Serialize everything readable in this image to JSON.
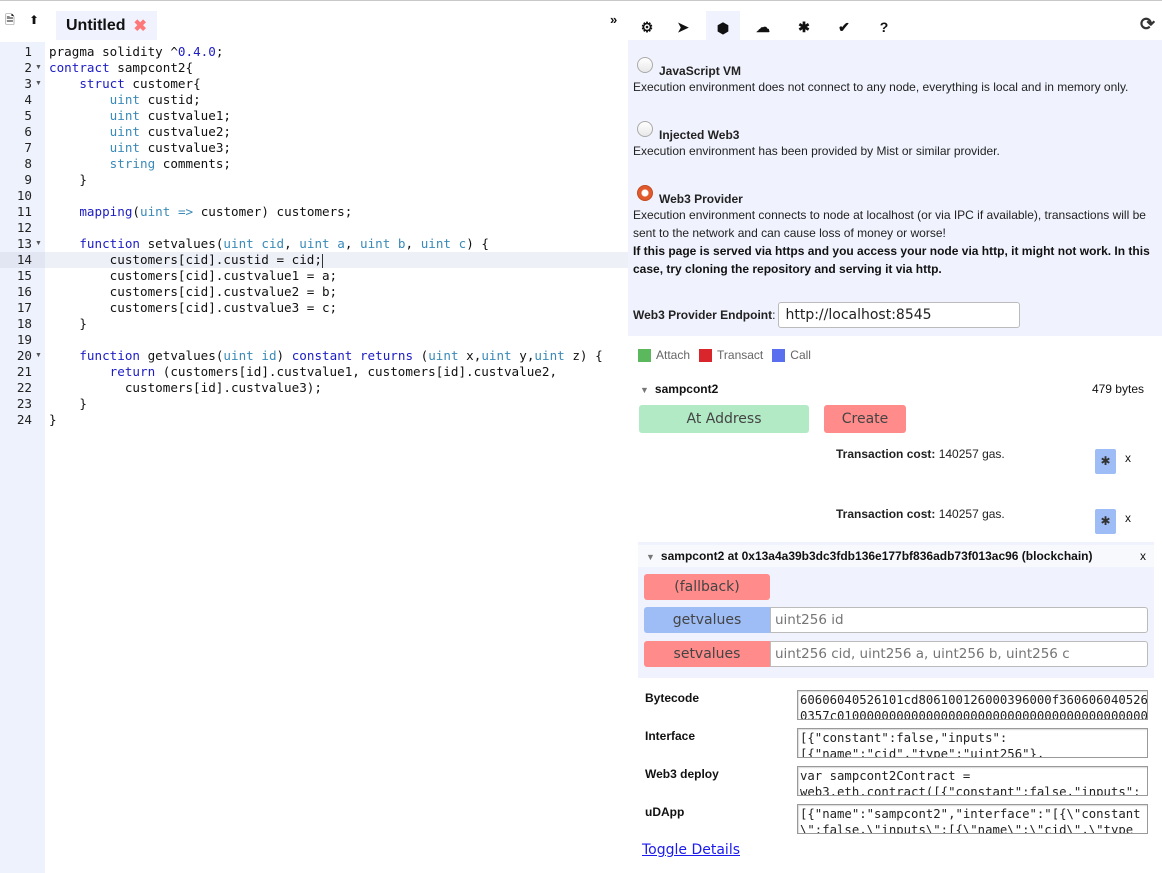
{
  "editor": {
    "toolbar_icons": [
      "file-icon",
      "upload-icon"
    ],
    "tab": {
      "name": "Untitled",
      "close_glyph": "✖"
    },
    "collapse_glyph": "»",
    "active_line": 14,
    "lines": [
      {
        "n": 1,
        "fold": false,
        "html": "pragma solidity ^<span class=\"num\">0.4.0</span>;"
      },
      {
        "n": 2,
        "fold": true,
        "html": "<span class=\"kw\">contract</span> sampcont2{"
      },
      {
        "n": 3,
        "fold": true,
        "html": "    <span class=\"kw\">struct</span> customer{"
      },
      {
        "n": 4,
        "fold": false,
        "html": "        <span class=\"ty\">uint</span> custid;"
      },
      {
        "n": 5,
        "fold": false,
        "html": "        <span class=\"ty\">uint</span> custvalue1;"
      },
      {
        "n": 6,
        "fold": false,
        "html": "        <span class=\"ty\">uint</span> custvalue2;"
      },
      {
        "n": 7,
        "fold": false,
        "html": "        <span class=\"ty\">uint</span> custvalue3;"
      },
      {
        "n": 8,
        "fold": false,
        "html": "        <span class=\"ty\">string</span> comments;"
      },
      {
        "n": 9,
        "fold": false,
        "html": "    }"
      },
      {
        "n": 10,
        "fold": false,
        "html": ""
      },
      {
        "n": 11,
        "fold": false,
        "html": "    <span class=\"kw\">mapping</span>(<span class=\"ty\">uint</span> <span class=\"ty\">=&gt;</span> customer) customers;"
      },
      {
        "n": 12,
        "fold": false,
        "html": ""
      },
      {
        "n": 13,
        "fold": true,
        "html": "    <span class=\"kw\">function</span> setvalues(<span class=\"ty\">uint</span> <span class=\"ty\">cid</span>, <span class=\"ty\">uint</span> <span class=\"ty\">a</span>, <span class=\"ty\">uint</span> <span class=\"ty\">b</span>, <span class=\"ty\">uint</span> <span class=\"ty\">c</span>) {"
      },
      {
        "n": 14,
        "fold": false,
        "html": "        customers[cid].custid = cid;<span class=\"cursor\"></span>"
      },
      {
        "n": 15,
        "fold": false,
        "html": "        customers[cid].custvalue1 = a;"
      },
      {
        "n": 16,
        "fold": false,
        "html": "        customers[cid].custvalue2 = b;"
      },
      {
        "n": 17,
        "fold": false,
        "html": "        customers[cid].custvalue3 = c;"
      },
      {
        "n": 18,
        "fold": false,
        "html": "    }"
      },
      {
        "n": 19,
        "fold": false,
        "html": ""
      },
      {
        "n": 20,
        "fold": true,
        "html": "    <span class=\"kw\">function</span> getvalues(<span class=\"ty\">uint</span> <span class=\"ty\">id</span>) <span class=\"kw\">constant</span> <span class=\"kw\">returns</span> (<span class=\"ty\">uint</span> x,<span class=\"ty\">uint</span> y,<span class=\"ty\">uint</span> z) {"
      },
      {
        "n": 21,
        "fold": false,
        "html": "        <span class=\"kw\">return</span> (customers[id].custvalue1, customers[id].custvalue2,"
      },
      {
        "n": 22,
        "fold": false,
        "html": "          customers[id].custvalue3);"
      },
      {
        "n": 23,
        "fold": false,
        "html": "    }"
      },
      {
        "n": 24,
        "fold": false,
        "html": "}"
      }
    ]
  },
  "right_toolbar": {
    "icons": [
      {
        "name": "settings-gear-icon",
        "glyph": "⚙"
      },
      {
        "name": "send-plane-icon",
        "glyph": "➤"
      },
      {
        "name": "contract-cube-icon",
        "glyph": "⬢",
        "selected": true
      },
      {
        "name": "cloud-upload-icon",
        "glyph": "☁"
      },
      {
        "name": "debugger-bug-icon",
        "glyph": "✱"
      },
      {
        "name": "analysis-check-icon",
        "glyph": "✔"
      },
      {
        "name": "help-question-icon",
        "glyph": "?"
      }
    ],
    "refresh_glyph": "⟳"
  },
  "environment": {
    "options": [
      {
        "id": "javascript-vm",
        "title": "JavaScript VM",
        "checked": false,
        "desc": "Execution environment does not connect to any node, everything is local and in memory only."
      },
      {
        "id": "injected-web3",
        "title": "Injected Web3",
        "checked": false,
        "desc": "Execution environment has been provided by Mist or similar provider."
      },
      {
        "id": "web3-provider",
        "title": "Web3 Provider",
        "checked": true,
        "desc": "Execution environment connects to node at localhost (or via IPC if available), transactions will be sent to the network and can cause loss of money or worse!",
        "warning": "If this page is served via https and you access your node via http, it might not work. In this case, try cloning the repository and serving it via http."
      }
    ],
    "endpoint_label": "Web3 Provider Endpoint",
    "endpoint_value": "http://localhost:8545"
  },
  "legend": [
    {
      "label": "Attach",
      "color": "#5cb85c"
    },
    {
      "label": "Transact",
      "color": "#d9262c"
    },
    {
      "label": "Call",
      "color": "#5a6ff0"
    }
  ],
  "contract": {
    "name": "sampcont2",
    "size": "479 bytes",
    "at_address_label": "At Address",
    "create_label": "Create"
  },
  "transactions": [
    {
      "label": "Transaction cost:",
      "value": "140257 gas.",
      "close": "x"
    },
    {
      "label": "Transaction cost:",
      "value": "140257 gas.",
      "close": "x"
    }
  ],
  "instance": {
    "title": "sampcont2 at 0x13a4a39b3dc3fdb136e177bf836adb73f013ac96 (blockchain)",
    "close": "x",
    "functions": [
      {
        "label": "(fallback)",
        "kind": "transact",
        "placeholder": null
      },
      {
        "label": "getvalues",
        "kind": "call",
        "placeholder": "uint256 id"
      },
      {
        "label": "setvalues",
        "kind": "transact",
        "placeholder": "uint256 cid, uint256 a, uint256 b, uint256 c"
      }
    ]
  },
  "details": [
    {
      "label": "Bytecode",
      "value": "60606040526101cd806100126000396000f36060604052600\n0357c0100000000000000000000000000000000000000000000"
    },
    {
      "label": "Interface",
      "value": "[{\"constant\":false,\"inputs\":\n[{\"name\":\"cid\",\"type\":\"uint256\"},"
    },
    {
      "label": "Web3 deploy",
      "value": "var sampcont2Contract =\nweb3.eth.contract([{\"constant\":false,\"inputs\":"
    },
    {
      "label": "uDApp",
      "value": "[{\"name\":\"sampcont2\",\"interface\":\"[{\\\"constant\n\\\":false,\\\"inputs\\\":[{\\\"name\\\":\\\"cid\\\",\\\"type"
    }
  ],
  "toggle_details": "Toggle Details"
}
